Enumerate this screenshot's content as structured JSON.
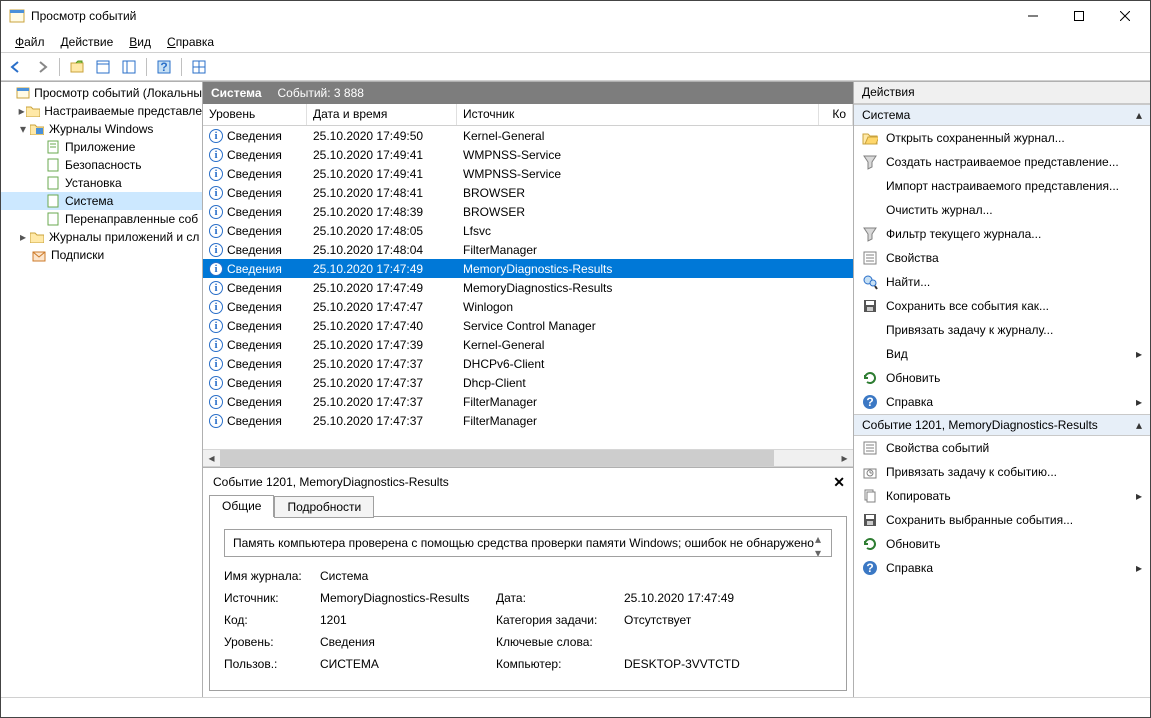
{
  "window": {
    "title": "Просмотр событий"
  },
  "menu": {
    "file": "Файл",
    "action": "Действие",
    "view": "Вид",
    "help": "Справка"
  },
  "tree": {
    "root": "Просмотр событий (Локальны",
    "custom": "Настраиваемые представле",
    "winlogs": "Журналы Windows",
    "app": "Приложение",
    "security": "Безопасность",
    "setup": "Установка",
    "system": "Система",
    "forwarded": "Перенаправленные соб",
    "applogs": "Журналы приложений и сл",
    "subs": "Подписки"
  },
  "gridHeader": {
    "title": "Система",
    "countLabel": "Событий: 3 888"
  },
  "cols": {
    "level": "Уровень",
    "date": "Дата и время",
    "source": "Источник",
    "code": "Ко"
  },
  "levelText": "Сведения",
  "rows": [
    {
      "date": "25.10.2020 17:49:50",
      "src": "Kernel-General"
    },
    {
      "date": "25.10.2020 17:49:41",
      "src": "WMPNSS-Service"
    },
    {
      "date": "25.10.2020 17:49:41",
      "src": "WMPNSS-Service"
    },
    {
      "date": "25.10.2020 17:48:41",
      "src": "BROWSER"
    },
    {
      "date": "25.10.2020 17:48:39",
      "src": "BROWSER"
    },
    {
      "date": "25.10.2020 17:48:05",
      "src": "Lfsvc"
    },
    {
      "date": "25.10.2020 17:48:04",
      "src": "FilterManager"
    },
    {
      "date": "25.10.2020 17:47:49",
      "src": "MemoryDiagnostics-Results",
      "selected": true
    },
    {
      "date": "25.10.2020 17:47:49",
      "src": "MemoryDiagnostics-Results"
    },
    {
      "date": "25.10.2020 17:47:47",
      "src": "Winlogon"
    },
    {
      "date": "25.10.2020 17:47:40",
      "src": "Service Control Manager"
    },
    {
      "date": "25.10.2020 17:47:39",
      "src": "Kernel-General"
    },
    {
      "date": "25.10.2020 17:47:37",
      "src": "DHCPv6-Client"
    },
    {
      "date": "25.10.2020 17:47:37",
      "src": "Dhcp-Client"
    },
    {
      "date": "25.10.2020 17:47:37",
      "src": "FilterManager"
    },
    {
      "date": "25.10.2020 17:47:37",
      "src": "FilterManager"
    }
  ],
  "detail": {
    "title": "Событие 1201, MemoryDiagnostics-Results",
    "tabGeneral": "Общие",
    "tabDetails": "Подробности",
    "message": "Память компьютера проверена с помощью средства проверки памяти Windows; ошибок не обнаружено",
    "labels": {
      "logname": "Имя журнала:",
      "source": "Источник:",
      "code": "Код:",
      "level": "Уровень:",
      "user": "Пользов.:",
      "date": "Дата:",
      "taskcat": "Категория задачи:",
      "keywords": "Ключевые слова:",
      "computer": "Компьютер:"
    },
    "values": {
      "logname": "Система",
      "source": "MemoryDiagnostics-Results",
      "code": "1201",
      "level": "Сведения",
      "user": "СИСТЕМА",
      "date": "25.10.2020 17:47:49",
      "taskcat": "Отсутствует",
      "keywords": "",
      "computer": "DESKTOP-3VVTCTD"
    }
  },
  "actionsTitle": "Действия",
  "actionsSystem": {
    "header": "Система",
    "open": "Открыть сохраненный журнал...",
    "createView": "Создать настраиваемое представление...",
    "importView": "Импорт настраиваемого представления...",
    "clear": "Очистить журнал...",
    "filter": "Фильтр текущего журнала...",
    "props": "Свойства",
    "find": "Найти...",
    "saveAll": "Сохранить все события как...",
    "attachLog": "Привязать задачу к журналу...",
    "view": "Вид",
    "refresh": "Обновить",
    "help": "Справка"
  },
  "actionsEvent": {
    "header": "Событие 1201, MemoryDiagnostics-Results",
    "eventProps": "Свойства событий",
    "attachEvt": "Привязать задачу к событию...",
    "copy": "Копировать",
    "saveSel": "Сохранить выбранные события...",
    "refresh": "Обновить",
    "help": "Справка"
  }
}
